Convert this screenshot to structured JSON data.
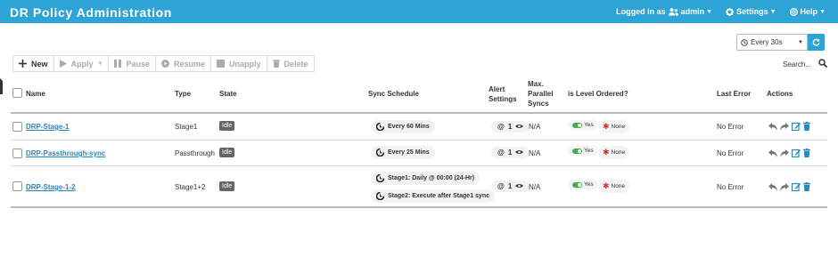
{
  "header": {
    "title": "DR Policy Administration",
    "logged_in_prefix": "Logged in as",
    "user": "admin",
    "settings": "Settings",
    "help": "Help"
  },
  "refresh": {
    "interval": "Every 30s"
  },
  "toolbar": {
    "new": "New",
    "apply": "Apply",
    "pause": "Pause",
    "resume": "Resume",
    "unapply": "Unapply",
    "delete": "Delete"
  },
  "search": {
    "label": "Search..."
  },
  "columns": {
    "name": "Name",
    "type": "Type",
    "state": "State",
    "sync_schedule": "Sync Schedule",
    "alert_settings_1": "Alert",
    "alert_settings_2": "Settings",
    "max_parallel_1": "Max.",
    "max_parallel_2": "Parallel",
    "max_parallel_3": "Syncs",
    "is_level_ordered": "is Level Ordered?",
    "last_error": "Last Error",
    "actions": "Actions"
  },
  "rows": [
    {
      "name": "DRP-Stage-1",
      "type": "Stage1",
      "state": "Idle",
      "schedules": [
        "Every 60 Mins"
      ],
      "alert_count": "1",
      "max_parallel": "N/A",
      "level_yes": "Yes",
      "level_none": "None",
      "last_error": "No Error"
    },
    {
      "name": "DRP-Passthrough-sync",
      "type": "Passthrough",
      "state": "Idle",
      "schedules": [
        "Every 25 Mins"
      ],
      "alert_count": "1",
      "max_parallel": "N/A",
      "level_yes": "Yes",
      "level_none": "None",
      "last_error": "No Error"
    },
    {
      "name": "DRP-Stage-1-2",
      "type": "Stage1+2",
      "state": "Idle",
      "schedules": [
        "Stage1: Daily @ 00:00 (24-Hr)",
        "Stage2: Execute after Stage1 sync"
      ],
      "alert_count": "1",
      "max_parallel": "N/A",
      "level_yes": "Yes",
      "level_none": "None",
      "last_error": "No Error"
    }
  ],
  "colors": {
    "brand": "#2ea3d6",
    "link": "#2a86c0",
    "badge": "#666666",
    "toggle_on": "#3fae49",
    "none_icon": "#d9302c"
  },
  "icons": {
    "schedule": "schedule-icon",
    "alert": "at-icon",
    "view": "eye-icon",
    "undo": "undo-icon",
    "redo": "redo-icon",
    "edit": "edit-icon",
    "delete": "trash-icon"
  }
}
